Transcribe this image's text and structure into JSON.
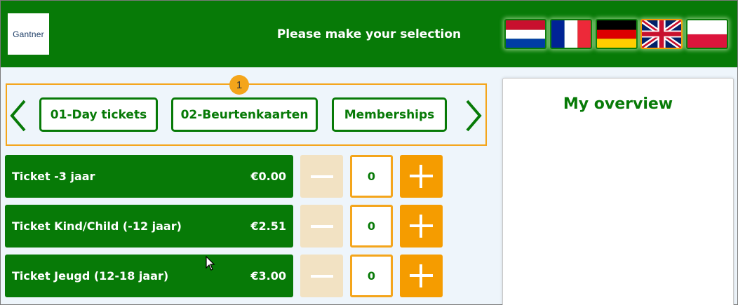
{
  "header": {
    "logo_text": "Gantner",
    "title": "Please make your selection",
    "background_color": "#077a07"
  },
  "languages": [
    {
      "name": "Dutch",
      "icon": "nl-flag-icon",
      "selected": false
    },
    {
      "name": "French",
      "icon": "fr-flag-icon",
      "selected": false
    },
    {
      "name": "German",
      "icon": "de-flag-icon",
      "selected": false
    },
    {
      "name": "English",
      "icon": "gb-flag-icon",
      "selected": true
    },
    {
      "name": "Polish",
      "icon": "pl-flag-icon",
      "selected": false
    }
  ],
  "categories": {
    "badge": "1",
    "items": [
      "01-Day tickets",
      "02-Beurtenkaarten",
      "Memberships"
    ],
    "prev_icon": "chevron-left-icon",
    "next_icon": "chevron-right-icon"
  },
  "tickets": [
    {
      "name": "Ticket -3 jaar",
      "price": "€0.00",
      "quantity": "0"
    },
    {
      "name": "Ticket Kind/Child (-12 jaar)",
      "price": "€2.51",
      "quantity": "0"
    },
    {
      "name": "Ticket Jeugd (12-18 jaar)",
      "price": "€3.00",
      "quantity": "0"
    }
  ],
  "overview": {
    "title": "My overview"
  },
  "colors": {
    "primary_green": "#077a07",
    "accent_orange": "#f59c00",
    "disabled_beige": "#f2e2c3"
  }
}
